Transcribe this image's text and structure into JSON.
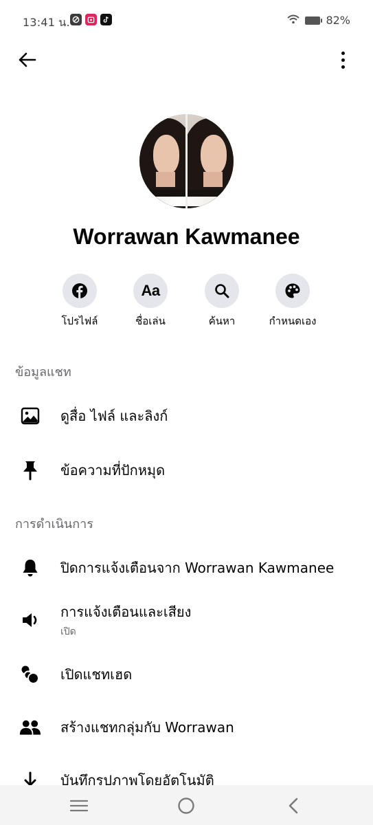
{
  "status_bar": {
    "time": "13:41 น.",
    "battery": "82%",
    "apps": [
      {
        "name": "shield-app-icon",
        "color": "#3c3c3c"
      },
      {
        "name": "calendar-app-icon",
        "color": "#e0245e"
      },
      {
        "name": "tiktok-app-icon",
        "color": "#111111"
      }
    ]
  },
  "profile": {
    "name": "Worrawan Kawmanee"
  },
  "actions": [
    {
      "label": "โปรไฟล์",
      "icon": "facebook-icon"
    },
    {
      "label": "ชื่อเล่น",
      "icon": "nickname-aa-icon",
      "glyph": "Aa"
    },
    {
      "label": "ค้นหา",
      "icon": "search-icon"
    },
    {
      "label": "กำหนดเอง",
      "icon": "palette-icon"
    }
  ],
  "sections": {
    "chat_info": {
      "title": "ข้อมูลแชท",
      "items": [
        {
          "label": "ดูสื่อ ไฟล์ และลิงก์",
          "icon": "image-icon"
        },
        {
          "label": "ข้อความที่ปักหมุด",
          "icon": "pin-icon"
        }
      ]
    },
    "actions": {
      "title": "การดำเนินการ",
      "items": [
        {
          "label": "ปิดการแจ้งเตือนจาก Worrawan Kawmanee",
          "icon": "bell-icon"
        },
        {
          "label": "การแจ้งเตือนและเสียง",
          "sublabel": "เปิด",
          "icon": "speaker-icon"
        },
        {
          "label": "เปิดแชทเฮด",
          "icon": "chat-heads-icon"
        },
        {
          "label": "สร้างแชทกลุ่มกับ Worrawan",
          "icon": "people-icon"
        },
        {
          "label": "บันทึกรูปภาพโดยอัตโนมัติ",
          "icon": "download-icon"
        }
      ]
    }
  },
  "colors": {
    "text": "#050505",
    "secondary": "#65676b",
    "action_bg": "#e4e6eb",
    "nav_bg": "#f4f4f4"
  }
}
